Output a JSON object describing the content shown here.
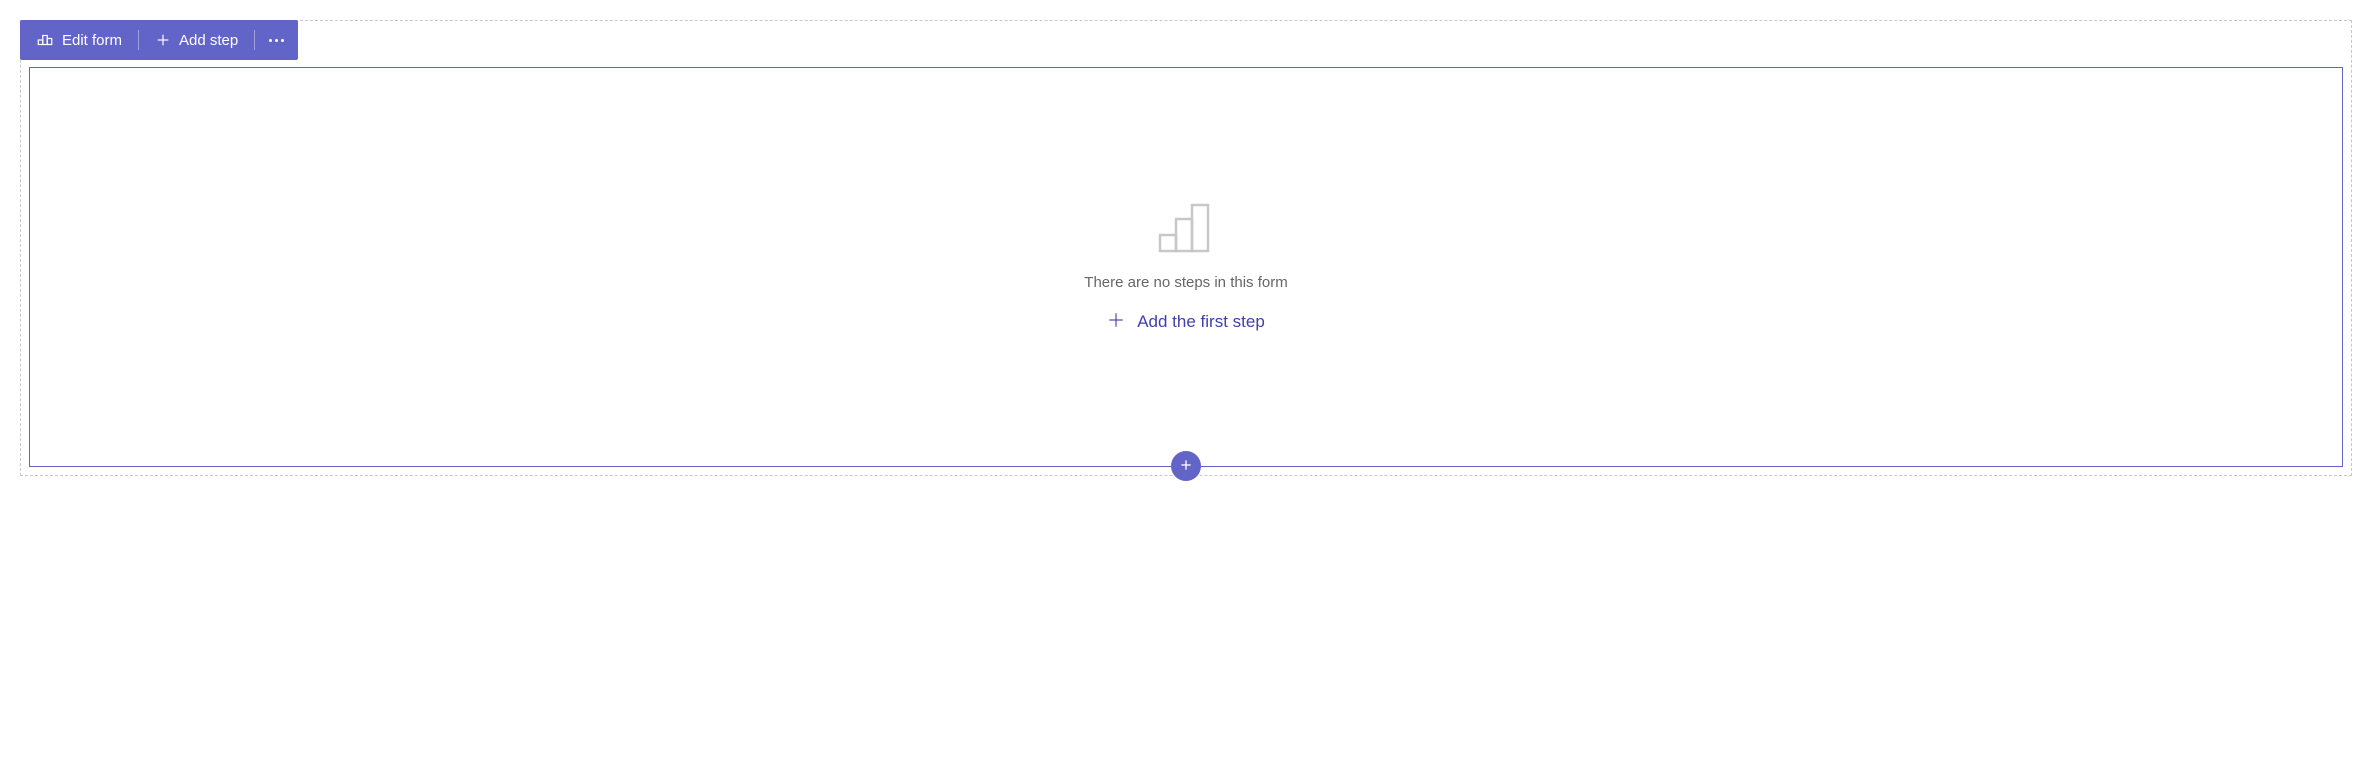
{
  "toolbar": {
    "edit_form_label": "Edit form",
    "add_step_label": "Add step"
  },
  "empty_state": {
    "message": "There are no steps in this form",
    "action_label": "Add the first step"
  },
  "colors": {
    "primary": "#6264c7",
    "text_muted": "#666666",
    "border_dashed": "#c8c8c8"
  }
}
